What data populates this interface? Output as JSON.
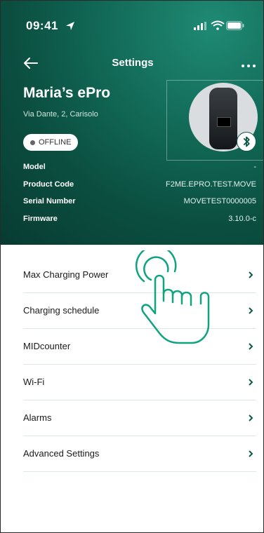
{
  "status": {
    "time": "09:41"
  },
  "nav": {
    "title": "Settings"
  },
  "device": {
    "name": "Maria’s ePro",
    "address": "Via Dante, 2, Carisolo",
    "status_badge": "OFFLINE"
  },
  "info": [
    {
      "key": "Model",
      "value": "-"
    },
    {
      "key": "Product Code",
      "value": "F2ME.EPRO.TEST.MOVE"
    },
    {
      "key": "Serial Number",
      "value": "MOVETEST0000005"
    },
    {
      "key": "Firmware",
      "value": "3.10.0-c"
    }
  ],
  "menu": [
    {
      "label": "Max Charging Power"
    },
    {
      "label": "Charging schedule"
    },
    {
      "label": "MIDcounter"
    },
    {
      "label": "Wi-Fi"
    },
    {
      "label": "Alarms"
    },
    {
      "label": "Advanced Settings"
    }
  ],
  "colors": {
    "accent": "#0d5a4a",
    "hero_dark": "#083b31",
    "hero_light": "#1f8a74",
    "hand_stroke": "#10a37f"
  },
  "icons": [
    "location-arrow-icon",
    "signal-icon",
    "wifi-icon",
    "battery-icon",
    "back-arrow-icon",
    "more-icon",
    "bluetooth-icon",
    "chevron-right-icon",
    "tap-hand-icon"
  ]
}
